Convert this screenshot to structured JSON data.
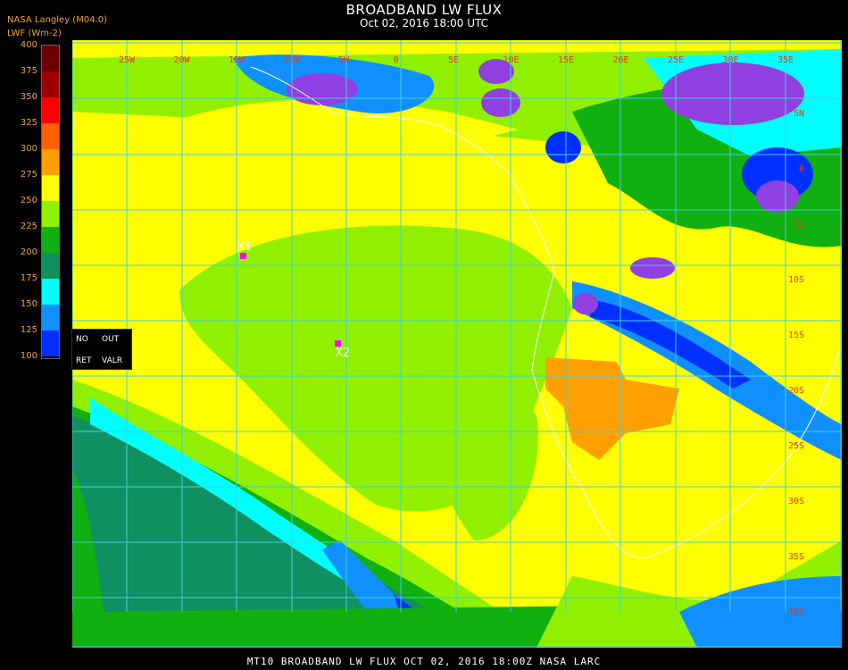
{
  "header": {
    "title": "BROADBAND LW FLUX",
    "subtitle": "Oct 02, 2016 18:00 UTC",
    "source": "NASA Langley (M04.0)",
    "unit": "LWF (Wm-2)"
  },
  "colorbar": {
    "ticks": [
      "400",
      "375",
      "350",
      "325",
      "300",
      "275",
      "250",
      "225",
      "200",
      "175",
      "150",
      "125",
      "100"
    ],
    "colors": [
      "#6b0000",
      "#a00000",
      "#ff0000",
      "#ff6000",
      "#ffa000",
      "#ffff00",
      "#90f000",
      "#10b010",
      "#109060",
      "#00ffff",
      "#1090ff",
      "#0030ff",
      "#9040e0"
    ]
  },
  "panel": {
    "no": "NO",
    "out": "OUT",
    "ret": "RET",
    "valr": "VALR"
  },
  "map": {
    "lon_labels": [
      "25W",
      "20W",
      "15W",
      "10W",
      "5W",
      "0",
      "5E",
      "10E",
      "15E",
      "20E",
      "25E",
      "30E",
      "35E"
    ],
    "lat_labels": [
      "5N",
      "0",
      "5S",
      "10S",
      "15S",
      "20S",
      "25S",
      "30S",
      "35S",
      "40S"
    ],
    "markers": [
      {
        "label": "X1"
      },
      {
        "label": "X2"
      }
    ],
    "marker_color": "#ff00ff",
    "grid_color": "#40d0e0",
    "coast_color": "#ffffff"
  },
  "footer": "MT10  BROADBAND LW FLUX   OCT 02, 2016 18:00Z   NASA LARC"
}
